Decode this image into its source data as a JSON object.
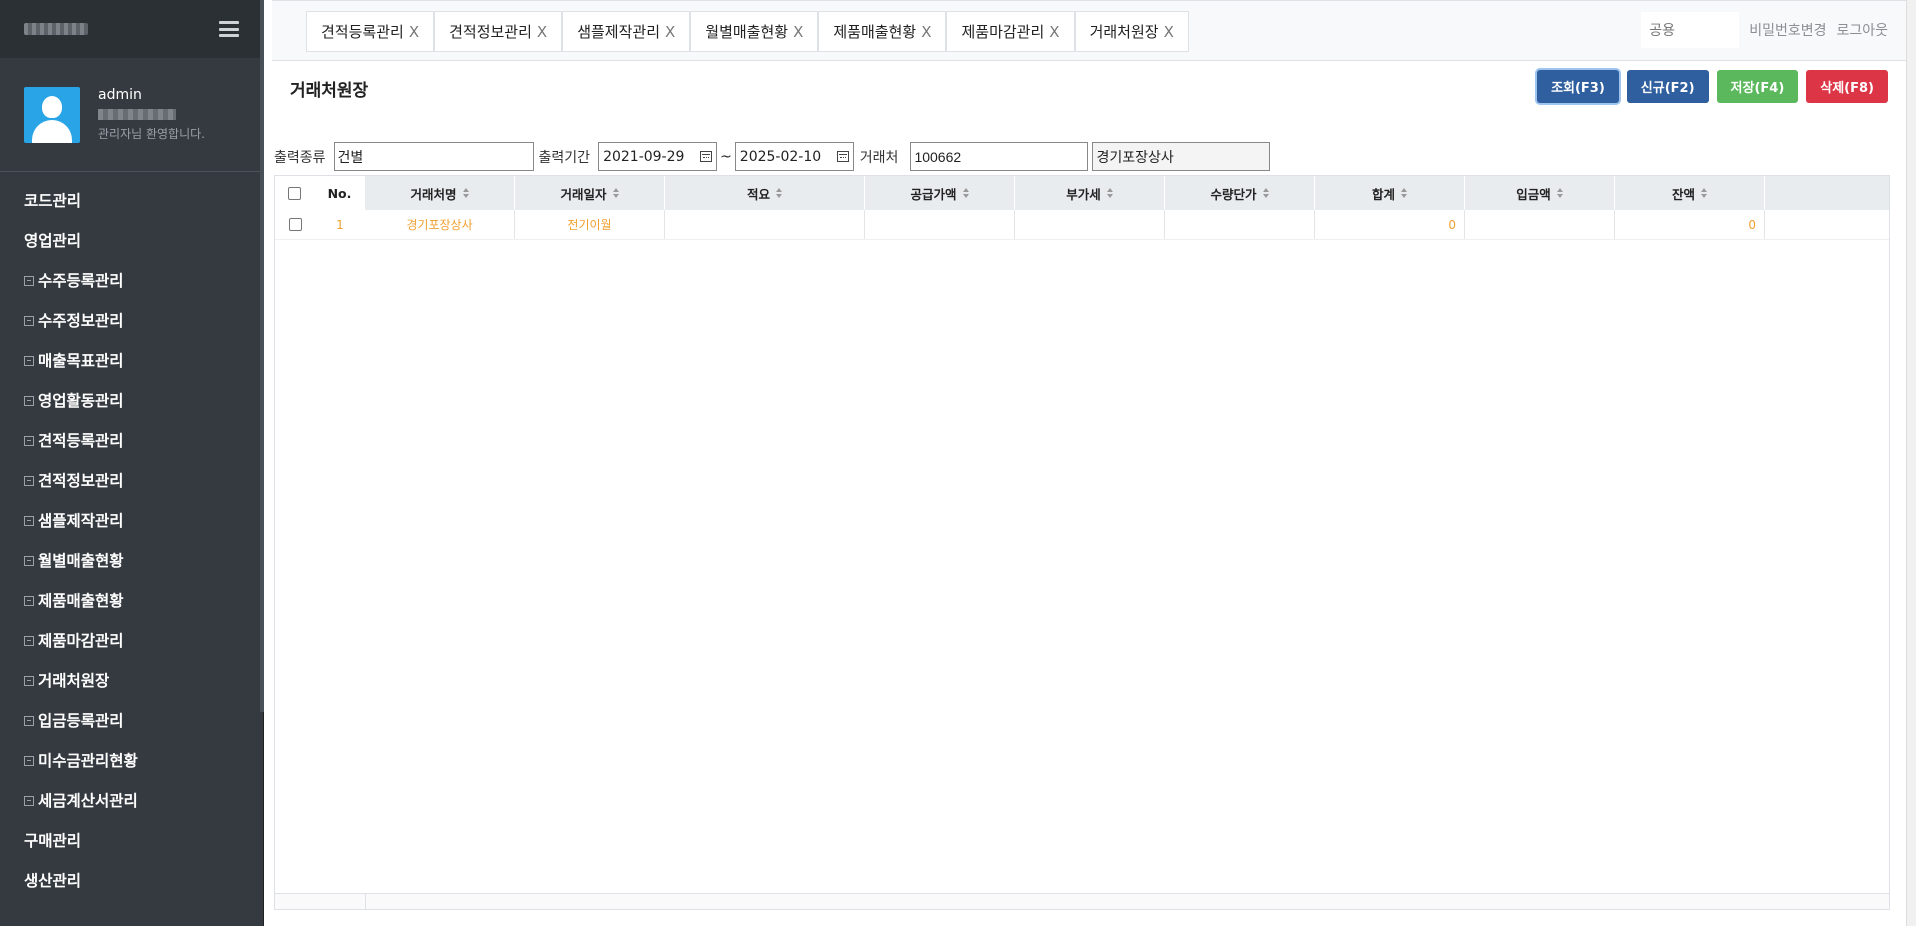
{
  "sidebar": {
    "user": {
      "name": "admin",
      "welcome": "관리자님 환영합니다."
    },
    "menu": [
      {
        "label": "코드관리",
        "sub": false
      },
      {
        "label": "영업관리",
        "sub": false
      },
      {
        "label": "수주등록관리",
        "sub": true
      },
      {
        "label": "수주정보관리",
        "sub": true
      },
      {
        "label": "매출목표관리",
        "sub": true
      },
      {
        "label": "영업활동관리",
        "sub": true
      },
      {
        "label": "견적등록관리",
        "sub": true
      },
      {
        "label": "견적정보관리",
        "sub": true
      },
      {
        "label": "샘플제작관리",
        "sub": true
      },
      {
        "label": "월별매출현황",
        "sub": true
      },
      {
        "label": "제품매출현황",
        "sub": true
      },
      {
        "label": "제품마감관리",
        "sub": true
      },
      {
        "label": "거래처원장",
        "sub": true
      },
      {
        "label": "입금등록관리",
        "sub": true
      },
      {
        "label": "미수금관리현황",
        "sub": true
      },
      {
        "label": "세금계산서관리",
        "sub": true
      },
      {
        "label": "구매관리",
        "sub": false
      },
      {
        "label": "생산관리",
        "sub": false
      }
    ]
  },
  "tabs": [
    {
      "label": "견적등록관리",
      "close": "X"
    },
    {
      "label": "견적정보관리",
      "close": "X"
    },
    {
      "label": "샘플제작관리",
      "close": "X"
    },
    {
      "label": "월별매출현황",
      "close": "X"
    },
    {
      "label": "제품매출현황",
      "close": "X"
    },
    {
      "label": "제품마감관리",
      "close": "X"
    },
    {
      "label": "거래처원장",
      "close": "X"
    }
  ],
  "topbar": {
    "search_placeholder": "공용",
    "change_password": "비밀번호변경",
    "logout": "로그아웃"
  },
  "page": {
    "title": "거래처원장",
    "buttons": {
      "search": "조회(F3)",
      "new": "신규(F2)",
      "save": "저장(F4)",
      "delete": "삭제(F8)"
    }
  },
  "filters": {
    "type_label": "출력종류",
    "type_value": "건별",
    "period_label": "출력기간",
    "date_from": "2021-09-29",
    "tilde": "~",
    "date_to": "2025-02-10",
    "client_label": "거래처",
    "client_code": "100662",
    "client_name": "경기포장상사"
  },
  "grid": {
    "columns": [
      "No.",
      "거래처명",
      "거래일자",
      "적요",
      "공급가액",
      "부가세",
      "수량단가",
      "합계",
      "입금액",
      "잔액"
    ],
    "rows": [
      {
        "no": "1",
        "client": "경기포장상사",
        "date": "전기이월",
        "memo": "",
        "supply": "",
        "vat": "",
        "unit": "",
        "total": "0",
        "deposit": "",
        "balance": "0"
      }
    ]
  },
  "colors": {
    "sidebar_bg": "#343a40",
    "accent_blue": "#2f5f9e",
    "save_green": "#5cb85c",
    "delete_red": "#dc3545",
    "row_text": "#f0a030"
  }
}
